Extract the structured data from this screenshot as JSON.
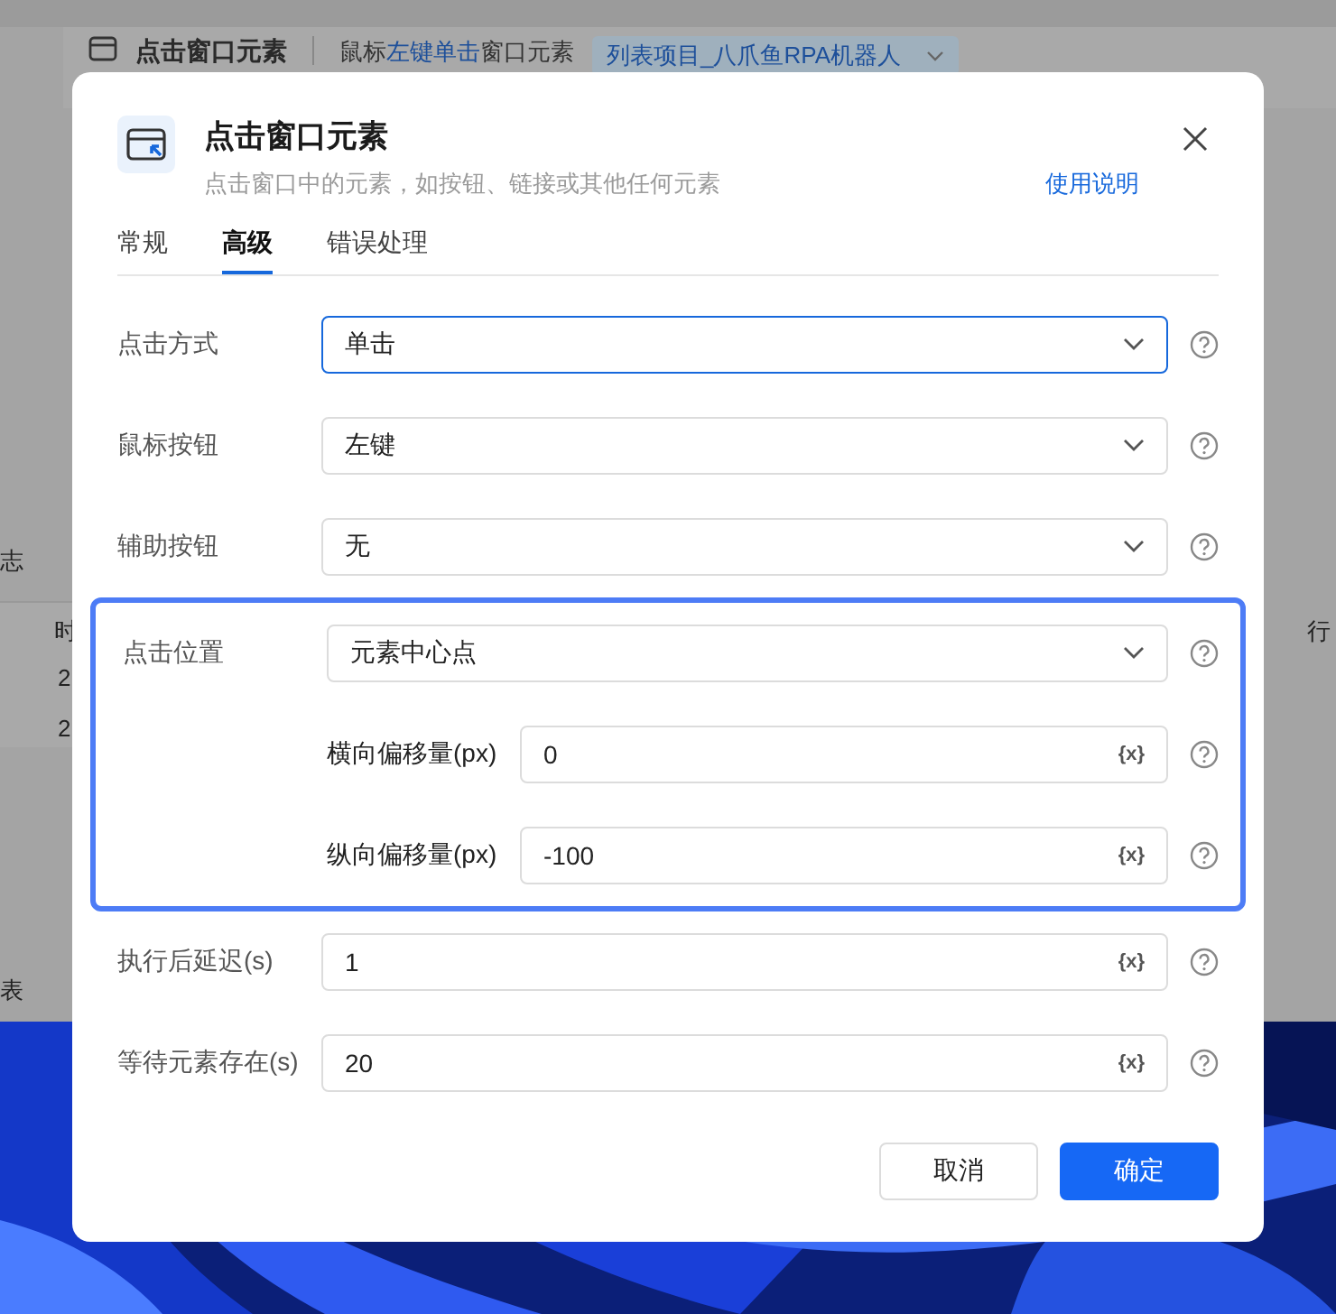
{
  "background": {
    "header_title": "点击窗口元素",
    "description": [
      {
        "text": "鼠标",
        "highlight": false
      },
      {
        "text": "左键单击",
        "highlight": true
      },
      {
        "text": "窗口元素",
        "highlight": false
      }
    ],
    "tag": "列表项目_八爪鱼RPA机器人",
    "left_tab": "志",
    "table_header": "时",
    "table_cells": [
      "2",
      "2"
    ],
    "bottom_tab": "表",
    "right_header": "行"
  },
  "dialog": {
    "title": "点击窗口元素",
    "subtitle": "点击窗口中的元素，如按钮、链接或其他任何元素",
    "help_link": "使用说明",
    "tabs": [
      {
        "label": "常规",
        "selected": false
      },
      {
        "label": "高级",
        "selected": true
      },
      {
        "label": "错误处理",
        "selected": false
      }
    ],
    "fields": [
      {
        "kind": "select",
        "label": "点击方式",
        "value": "单击",
        "focused": true
      },
      {
        "kind": "select",
        "label": "鼠标按钮",
        "value": "左键",
        "focused": false
      },
      {
        "kind": "select",
        "label": "辅助按钮",
        "value": "无",
        "focused": false
      },
      {
        "kind": "group",
        "highlighted": true,
        "label": "点击位置",
        "value": "元素中心点",
        "children": [
          {
            "kind": "variable",
            "label": "横向偏移量(px)",
            "value": "0",
            "variable_button": "{x}"
          },
          {
            "kind": "variable",
            "label": "纵向偏移量(px)",
            "value": "-100",
            "variable_button": "{x}"
          }
        ]
      },
      {
        "kind": "variable",
        "label": "执行后延迟(s)",
        "value": "1",
        "variable_button": "{x}"
      },
      {
        "kind": "variable",
        "label": "等待元素存在(s)",
        "value": "20",
        "variable_button": "{x}"
      }
    ],
    "buttons": [
      {
        "label": "取消",
        "kind": "secondary"
      },
      {
        "label": "确定",
        "kind": "primary"
      }
    ]
  }
}
